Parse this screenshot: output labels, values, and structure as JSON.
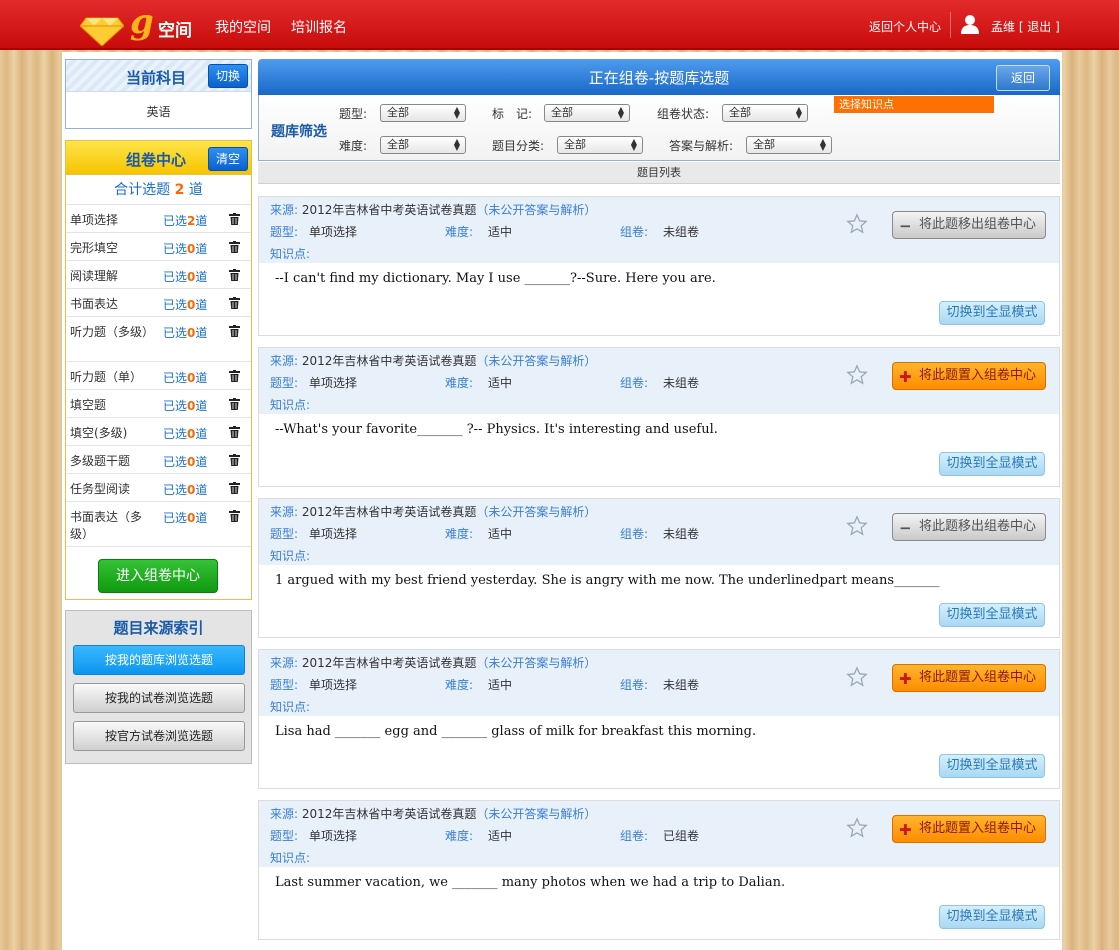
{
  "header": {
    "logo_letter": "g",
    "logo_text": "空间",
    "nav": [
      "我的空间",
      "培训报名"
    ],
    "personal_center": "返回个人中心",
    "user_text": "孟维 [ 退出 ]"
  },
  "subject": {
    "title": "当前科目",
    "switch_label": "切换",
    "value": "英语"
  },
  "center": {
    "title": "组卷中心",
    "clear_label": "清空",
    "total_prefix": "合计选题",
    "total_count": "2",
    "total_suffix": "道",
    "selected_prefix": "已选",
    "unit": "道",
    "items": [
      {
        "name": "单项选择",
        "count": "2"
      },
      {
        "name": "完形填空",
        "count": "0"
      },
      {
        "name": "阅读理解",
        "count": "0"
      },
      {
        "name": "书面表达",
        "count": "0"
      },
      {
        "name": "听力题（多级）",
        "count": "0"
      },
      {
        "name": "听力题（单）",
        "count": "0"
      },
      {
        "name": "填空题",
        "count": "0"
      },
      {
        "name": "填空(多级)",
        "count": "0"
      },
      {
        "name": "多级题干题",
        "count": "0"
      },
      {
        "name": "任务型阅读",
        "count": "0"
      },
      {
        "name": "书面表达（多级）",
        "count": "0"
      }
    ],
    "enter_label": "进入组卷中心"
  },
  "source_index": {
    "title": "题目来源索引",
    "buttons": [
      "按我的题库浏览选题",
      "按我的试卷浏览选题",
      "按官方试卷浏览选题"
    ]
  },
  "main": {
    "title": "正在组卷-按题库选题",
    "back_label": "返回",
    "filter_title": "题库筛选",
    "filters": {
      "type_label": "题型:",
      "type_value": "全部",
      "mark_label": "标　记:",
      "mark_value": "全部",
      "status_label": "组卷状态:",
      "status_value": "全部",
      "knowledge_label": "选择知识点",
      "difficulty_label": "难度:",
      "difficulty_value": "全部",
      "category_label": "题目分类:",
      "category_value": "全部",
      "answer_label": "答案与解析:",
      "answer_value": "全部"
    },
    "list_title": "题目列表"
  },
  "question_labels": {
    "source": "来源:",
    "type": "题型:",
    "difficulty": "难度:",
    "status": "组卷:",
    "knowledge": "知识点:",
    "full_mode": "切换到全显模式",
    "remove": "将此题移出组卷中心",
    "add": "将此题置入组卷中心"
  },
  "questions": [
    {
      "source": "2012年吉林省中考英语试卷真题",
      "answer_note": "（未公开答案与解析）",
      "type": "单项选择",
      "difficulty": "适中",
      "status": "未组卷",
      "action": "remove",
      "text": "--I can't find my dictionary. May I use _______?--Sure. Here you are."
    },
    {
      "source": "2012年吉林省中考英语试卷真题",
      "answer_note": "（未公开答案与解析）",
      "type": "单项选择",
      "difficulty": "适中",
      "status": "未组卷",
      "action": "add",
      "text": "--What's your favorite_______ ?-- Physics. It's interesting and useful."
    },
    {
      "source": "2012年吉林省中考英语试卷真题",
      "answer_note": "（未公开答案与解析）",
      "type": "单项选择",
      "difficulty": "适中",
      "status": "未组卷",
      "action": "remove",
      "text": "1 argued with my best friend yesterday. She is angry with me now. The underlinedpart means_______"
    },
    {
      "source": "2012年吉林省中考英语试卷真题",
      "answer_note": "（未公开答案与解析）",
      "type": "单项选择",
      "difficulty": "适中",
      "status": "未组卷",
      "action": "add",
      "text": "Lisa had _______ egg and _______ glass of milk for breakfast this morning."
    },
    {
      "source": "2012年吉林省中考英语试卷真题",
      "answer_note": "（未公开答案与解析）",
      "type": "单项选择",
      "difficulty": "适中",
      "status": "已组卷",
      "action": "add",
      "text": "Last summer vacation, we _______ many photos when we had a trip to Dalian."
    }
  ]
}
